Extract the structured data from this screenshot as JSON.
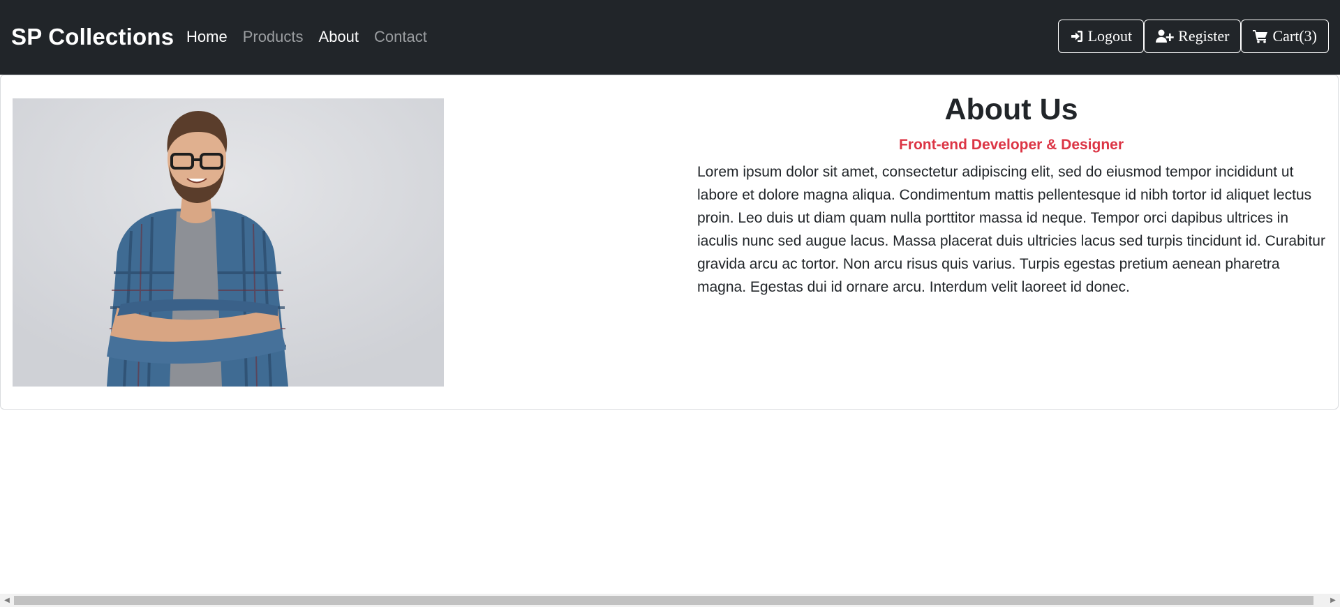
{
  "navbar": {
    "brand": "SP Collections",
    "links": [
      {
        "label": "Home",
        "active": true
      },
      {
        "label": "Products",
        "active": false
      },
      {
        "label": "About",
        "active": true
      },
      {
        "label": "Contact",
        "active": false
      }
    ],
    "buttons": {
      "logout": {
        "label": "Logout",
        "icon": "sign-in-icon"
      },
      "register": {
        "label": "Register",
        "icon": "user-plus-icon"
      },
      "cart": {
        "label": "Cart(3)",
        "icon": "shopping-cart-icon"
      }
    }
  },
  "about": {
    "title": "About Us",
    "subtitle": "Front-end Developer & Designer",
    "body": "Lorem ipsum dolor sit amet, consectetur adipiscing elit, sed do eiusmod tempor incididunt ut labore et dolore magna aliqua. Condimentum mattis pellentesque id nibh tortor id aliquet lectus proin. Leo duis ut diam quam nulla porttitor massa id neque. Tempor orci dapibus ultrices in iaculis nunc sed augue lacus. Massa placerat duis ultricies lacus sed turpis tincidunt id. Curabitur gravida arcu ac tortor. Non arcu risus quis varius. Turpis egestas pretium aenean pharetra magna. Egestas dui id ornare arcu. Interdum velit laoreet id donec."
  },
  "colors": {
    "navbar_bg": "#212529",
    "subtitle": "#dc3545",
    "text": "#212529"
  }
}
